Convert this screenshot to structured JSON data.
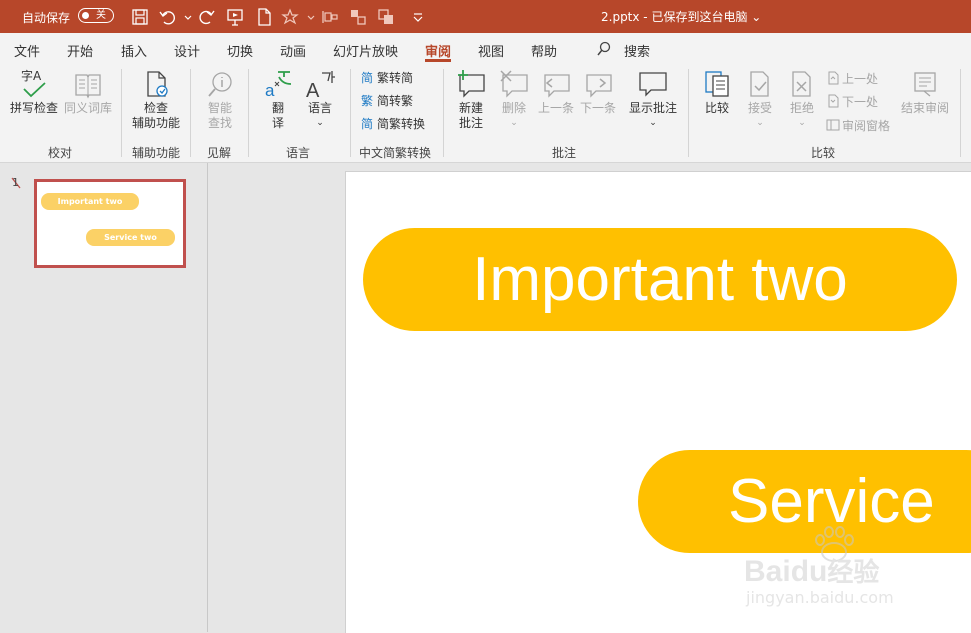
{
  "titlebar": {
    "autosave_label": "自动保存",
    "autosave_state": "关",
    "doc_title": "2.pptx - 已保存到这台电脑 ⌄",
    "accent": "#b7472a"
  },
  "tabs": [
    "文件",
    "开始",
    "插入",
    "设计",
    "切换",
    "动画",
    "幻灯片放映",
    "审阅",
    "视图",
    "帮助",
    "搜索"
  ],
  "ribbon": {
    "proofing": {
      "spell": "拼写检查",
      "thesaurus": "同义词库",
      "group": "校对",
      "spell_icon": "字A"
    },
    "accessibility": {
      "check": "检查",
      "check2": "辅助功能",
      "group": "辅助功能"
    },
    "insights": {
      "smart": "智能",
      "smart2": "查找",
      "group": "见解"
    },
    "language": {
      "translate": "翻",
      "translate2": "译",
      "lang": "语言",
      "group": "语言",
      "icon_text": "字"
    },
    "chinese": {
      "t2s": "繁转简",
      "s2t": "简转繁",
      "conv": "简繁转换",
      "group": "中文简繁转换"
    },
    "comments": {
      "new": "新建",
      "new2": "批注",
      "delete": "删除",
      "prev": "上一条",
      "next": "下一条",
      "show": "显示批注",
      "group": "批注"
    },
    "compare": {
      "compare": "比较",
      "accept": "接受",
      "reject": "拒绝",
      "prev_change": "上一处",
      "next_change": "下一处",
      "pane": "审阅窗格",
      "end": "结束审阅",
      "group": "比较"
    }
  },
  "thumbnail": {
    "number": "1",
    "pill1": "Important two",
    "pill2": "Service  two",
    "border_color": "#c0504d",
    "pill_color": "#fbd166"
  },
  "slide": {
    "pill1": "Important two",
    "pill2": "Service",
    "pill_color": "#ffc000"
  },
  "watermark": {
    "brand": "Bai",
    "brand2": "du",
    "brand_cn": "经验",
    "url": "jingyan.baidu.com"
  }
}
